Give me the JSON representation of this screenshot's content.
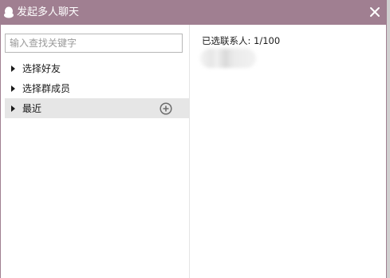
{
  "window": {
    "title": "发起多人聊天",
    "title_icon": "qq-penguin-icon",
    "close_icon": "close-icon",
    "accent": "#a07f91"
  },
  "left": {
    "search_placeholder": "输入查找关键字",
    "groups": [
      {
        "label": "选择好友",
        "selected": false
      },
      {
        "label": "选择群成员",
        "selected": false
      },
      {
        "label": "最近",
        "selected": true
      }
    ],
    "add_icon": "add-circle-icon"
  },
  "right": {
    "selected_count": "已选联系人: 1/100"
  }
}
